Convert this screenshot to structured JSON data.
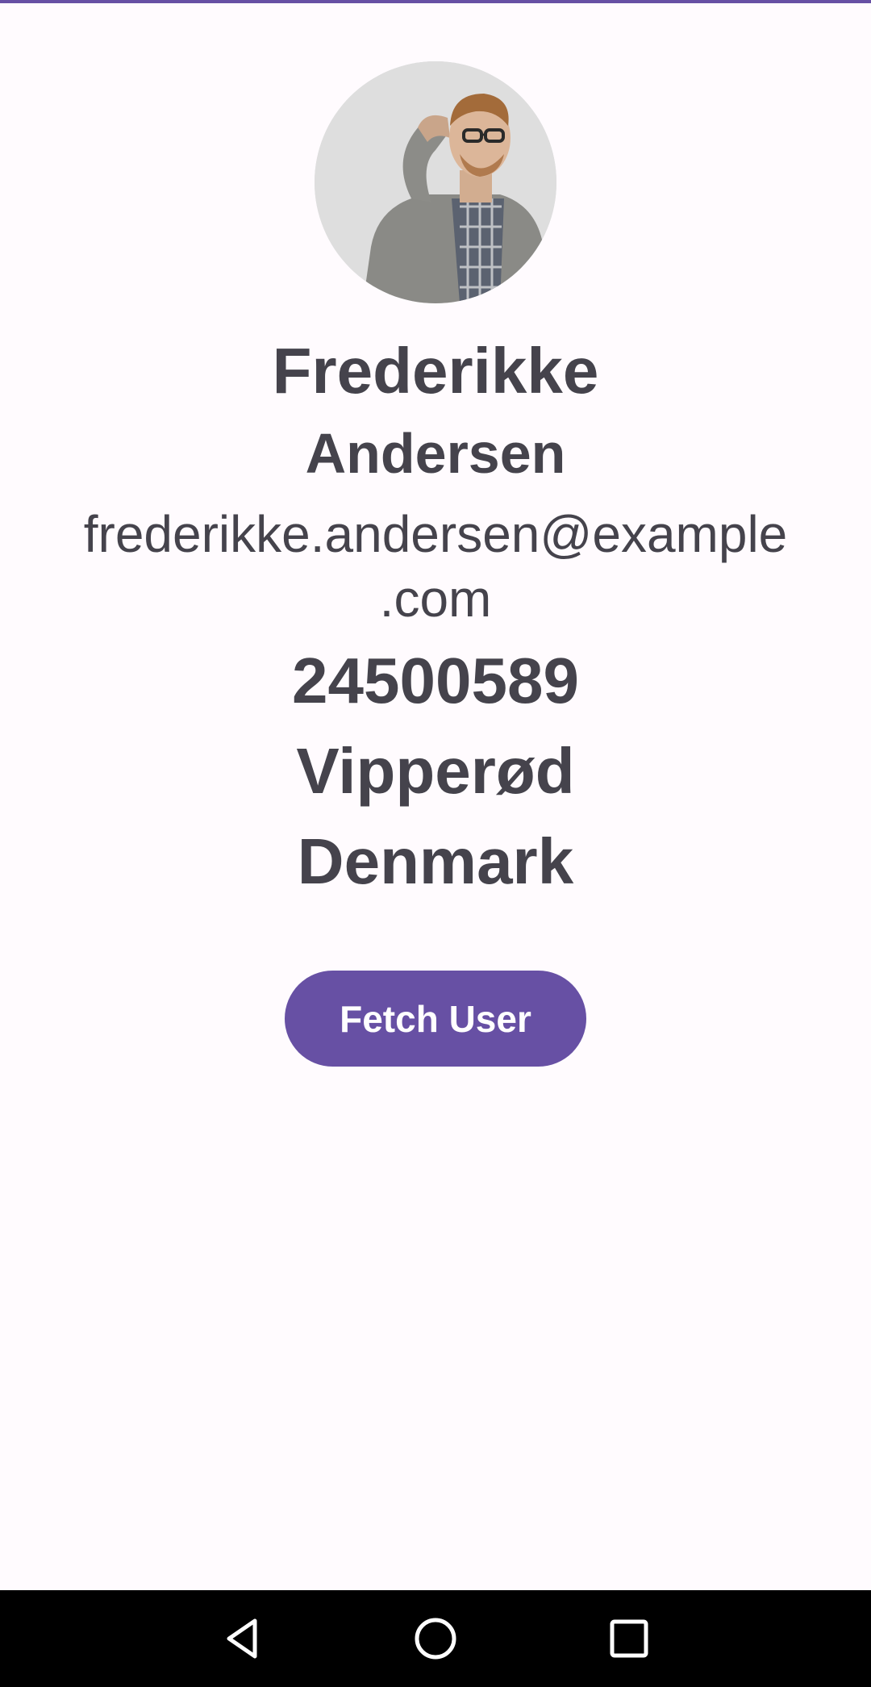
{
  "user": {
    "avatar_icon": "user-photo",
    "first_name": "Frederikke",
    "last_name": "Andersen",
    "email_line1": "frederikke.andersen@example",
    "email_line2": ".com",
    "phone": "24500589",
    "city": "Vipperød",
    "country": "Denmark"
  },
  "actions": {
    "fetch_label": "Fetch User"
  },
  "colors": {
    "accent": "#6750a4",
    "text": "#45434c",
    "background": "#fffbfe",
    "nav_bar": "#000000"
  },
  "nav_bar": {
    "back_icon": "back-triangle-icon",
    "home_icon": "home-circle-icon",
    "recents_icon": "recents-square-icon"
  }
}
